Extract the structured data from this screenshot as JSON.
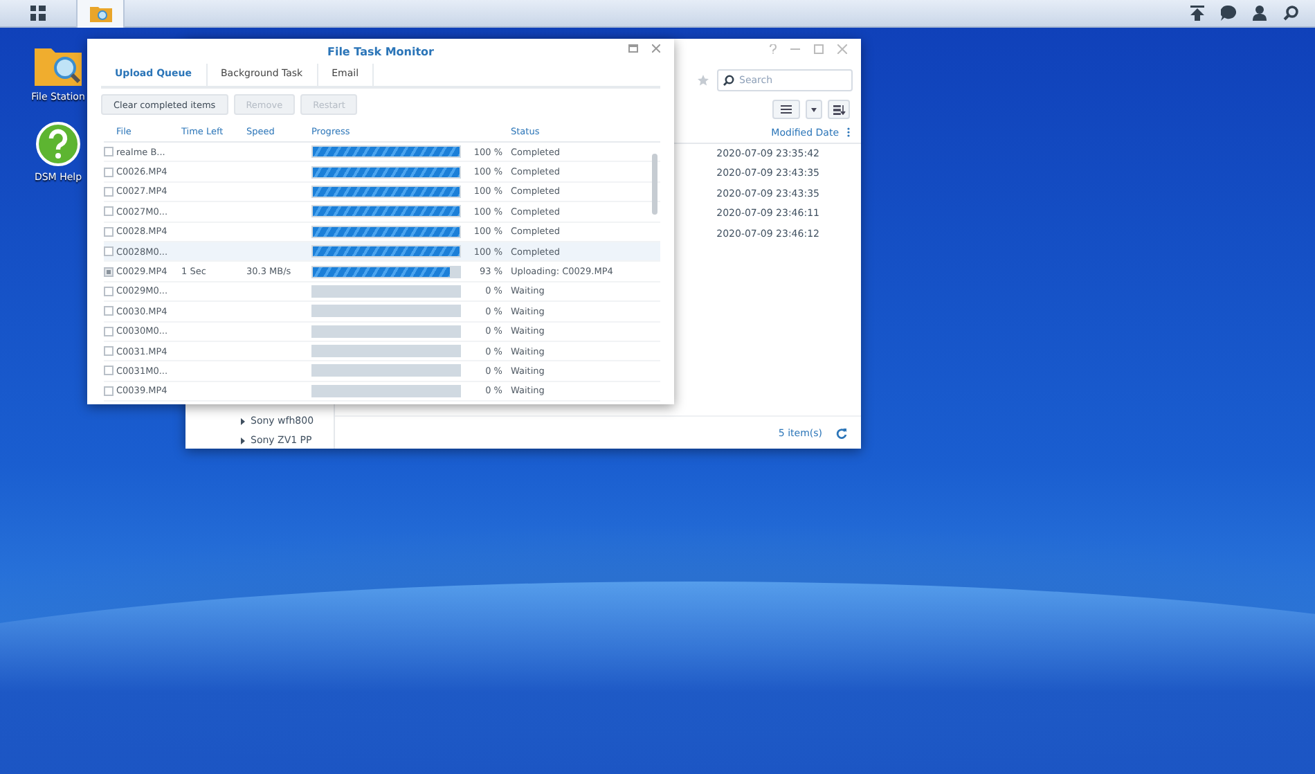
{
  "desktop_icons": [
    {
      "label": "File Station",
      "kind": "folder"
    },
    {
      "label": "DSM Help",
      "kind": "help"
    }
  ],
  "file_station": {
    "search": {
      "placeholder": "Search"
    },
    "columns": [
      "Modified Date"
    ],
    "dates": [
      "2020-07-09 23:35:42",
      "2020-07-09 23:43:35",
      "2020-07-09 23:43:35",
      "2020-07-09 23:46:11",
      "2020-07-09 23:46:12"
    ],
    "tree": [
      "Sony wfh800",
      "Sony ZV1 PP"
    ],
    "item_count": "5 item(s)"
  },
  "monitor": {
    "title": "File Task Monitor",
    "tabs": [
      {
        "label": "Upload Queue",
        "selected": true
      },
      {
        "label": "Background Task",
        "selected": false
      },
      {
        "label": "Email",
        "selected": false
      }
    ],
    "buttons": [
      {
        "label": "Clear completed items",
        "disabled": false
      },
      {
        "label": "Remove",
        "disabled": true
      },
      {
        "label": "Restart",
        "disabled": true
      }
    ],
    "columns": [
      "File",
      "Time Left",
      "Speed",
      "Progress",
      "Status"
    ],
    "rows": [
      {
        "file": "realme B...",
        "level": 1,
        "percent": "100 %",
        "status": "Completed",
        "kind": "file",
        "selected": false
      },
      {
        "file": "C0026.MP4",
        "level": 1,
        "percent": "100 %",
        "status": "Completed",
        "kind": "file",
        "selected": false
      },
      {
        "file": "C0027.MP4",
        "level": 1,
        "percent": "100 %",
        "status": "Completed",
        "kind": "file",
        "selected": false
      },
      {
        "file": "C0027M0...",
        "level": 1,
        "percent": "100 %",
        "status": "Completed",
        "kind": "file",
        "selected": false
      },
      {
        "file": "C0028.MP4",
        "level": 1,
        "percent": "100 %",
        "status": "Completed",
        "kind": "file",
        "selected": false
      },
      {
        "file": "C0028M0...",
        "level": 1,
        "percent": "100 %",
        "status": "Completed",
        "kind": "file",
        "selected": true
      },
      {
        "file": "C0029.MP4",
        "time_left": "1 Sec",
        "speed": "30.3 MB/s",
        "level": 0.93,
        "percent": "93 %",
        "status": "Uploading: C0029.MP4",
        "kind": "uploading",
        "selected": false
      },
      {
        "file": "C0029M0...",
        "level": 0,
        "percent": "0 %",
        "status": "Waiting",
        "kind": "file",
        "selected": false
      },
      {
        "file": "C0030.MP4",
        "level": 0,
        "percent": "0 %",
        "status": "Waiting",
        "kind": "file",
        "selected": false
      },
      {
        "file": "C0030M0...",
        "level": 0,
        "percent": "0 %",
        "status": "Waiting",
        "kind": "file",
        "selected": false
      },
      {
        "file": "C0031.MP4",
        "level": 0,
        "percent": "0 %",
        "status": "Waiting",
        "kind": "file",
        "selected": false
      },
      {
        "file": "C0031M0...",
        "level": 0,
        "percent": "0 %",
        "status": "Waiting",
        "kind": "file",
        "selected": false
      },
      {
        "file": "C0039.MP4",
        "level": 0,
        "percent": "0 %",
        "status": "Waiting",
        "kind": "file",
        "selected": false
      }
    ]
  }
}
